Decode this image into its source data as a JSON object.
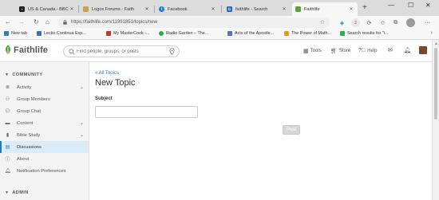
{
  "browser": {
    "tabs": [
      {
        "title": "US & Canada - BBC N",
        "icon": "bbc-icon"
      },
      {
        "title": "Logos Forums - Faith",
        "icon": "logos-icon"
      },
      {
        "title": "Facebook",
        "icon": "facebook-icon"
      },
      {
        "title": "faithlife - Search",
        "icon": "search-engine-icon"
      },
      {
        "title": "Faithlife",
        "icon": "faithlife-icon",
        "active": true
      }
    ],
    "url": "https://faithlife.com/11991851/topics/new",
    "bookmarks": [
      {
        "label": "New tab",
        "color": "#2a7fc1"
      },
      {
        "label": "Lectio Continua Exp...",
        "color": "#3b6fb5"
      },
      {
        "label": "My MasterCook -...",
        "color": "#c0392b"
      },
      {
        "label": "Radio Garden – The...",
        "color": "#2eae4f"
      },
      {
        "label": "Acts of the Apostle...",
        "color": "#4a7ab5"
      },
      {
        "label": "The Power of Math...",
        "color": "#e0a020"
      },
      {
        "label": "Search results for \"i...",
        "color": "#2eae4f"
      }
    ],
    "profile_badge": "2"
  },
  "header": {
    "logo_text": "Faithlife",
    "search_placeholder": "Find people, groups, or posts",
    "tools_label": "Tools",
    "store_label": "Store",
    "help_label": "Help"
  },
  "sidebar": {
    "community_label": "COMMUNITY",
    "items": [
      {
        "label": "Activity",
        "icon": "activity-icon",
        "expandable": true
      },
      {
        "label": "Group Members",
        "icon": "group-members-icon"
      },
      {
        "label": "Group Chat",
        "icon": "chat-icon"
      },
      {
        "label": "Content",
        "icon": "folder-icon",
        "expandable": true
      },
      {
        "label": "Bible Study",
        "icon": "book-icon",
        "expandable": true
      },
      {
        "label": "Discussions",
        "icon": "discussions-icon",
        "active": true
      },
      {
        "label": "About",
        "icon": "info-icon"
      },
      {
        "label": "Notification Preferences",
        "icon": "bell-icon"
      }
    ],
    "admin_label": "ADMIN"
  },
  "main": {
    "back_link": "« All Topics",
    "title": "New Topic",
    "subject_label": "Subject",
    "subject_value": "",
    "post_label": "Post"
  }
}
